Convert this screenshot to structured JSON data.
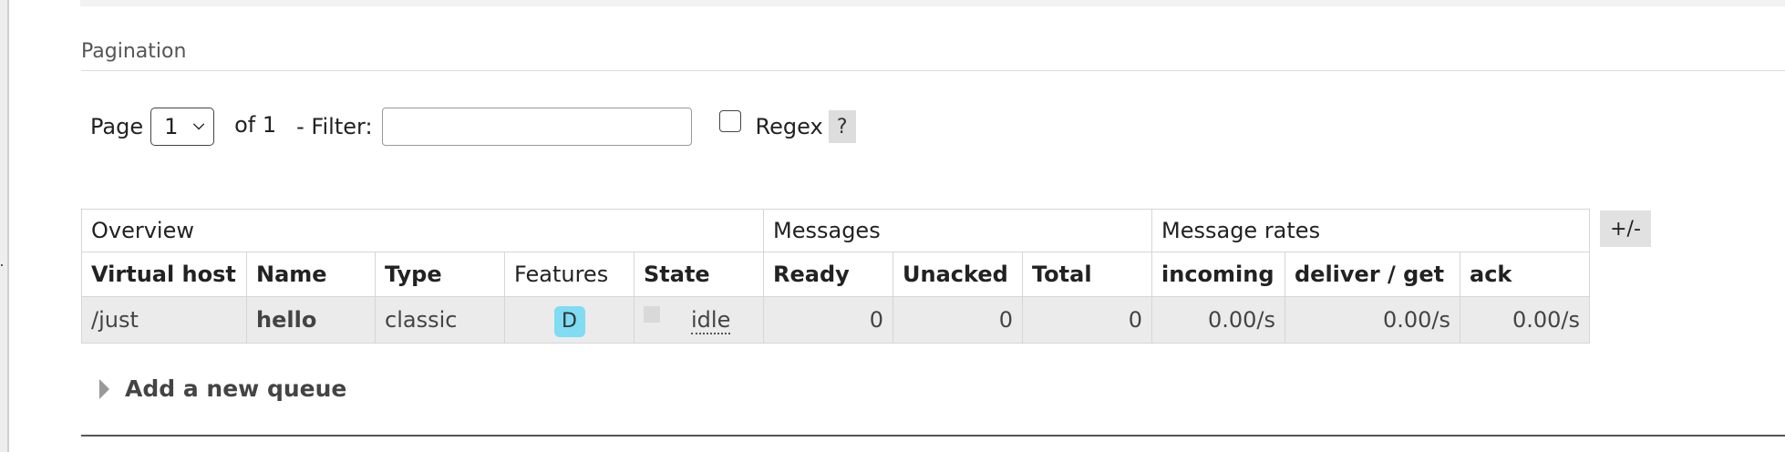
{
  "pagination": {
    "section_title": "Pagination",
    "page_label": "Page",
    "page_selected": "1",
    "of_text": "of 1",
    "filter_label": "- Filter:",
    "filter_value": "",
    "regex_label": "Regex",
    "regex_checked": false,
    "help_label": "?"
  },
  "table": {
    "group_headers": [
      "Overview",
      "Messages",
      "Message rates"
    ],
    "columns": [
      "Virtual host",
      "Name",
      "Type",
      "Features",
      "State",
      "Ready",
      "Unacked",
      "Total",
      "incoming",
      "deliver / get",
      "ack"
    ],
    "rows": [
      {
        "virtual_host": "/just",
        "name": "hello",
        "type": "classic",
        "features": "D",
        "state": "idle",
        "ready": "0",
        "unacked": "0",
        "total": "0",
        "incoming": "0.00/s",
        "deliver_get": "0.00/s",
        "ack": "0.00/s"
      }
    ],
    "toggle_label": "+/-"
  },
  "add_queue": {
    "label": "Add a new queue"
  },
  "colors": {
    "feature_badge": "#7fdcf2",
    "row_background": "#ebebeb",
    "button_background": "#e1e1e1"
  }
}
